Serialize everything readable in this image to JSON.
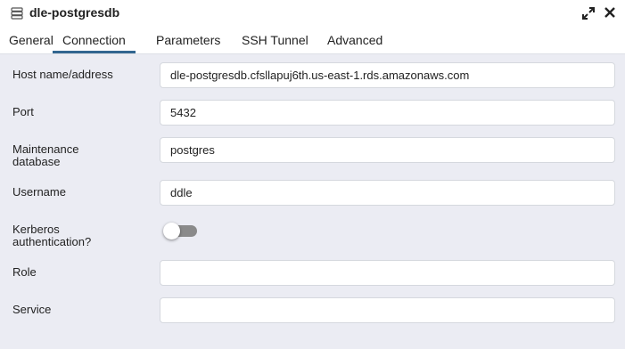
{
  "dialog": {
    "title": "dle-postgresdb",
    "icons": {
      "server": "server-database-icon",
      "expand": "expand-icon",
      "close": "close-icon"
    }
  },
  "tabs": [
    {
      "label": "General",
      "active": false
    },
    {
      "label": "Connection",
      "active": true
    },
    {
      "label": "Parameters",
      "active": false
    },
    {
      "label": "SSH Tunnel",
      "active": false
    },
    {
      "label": "Advanced",
      "active": false
    }
  ],
  "form": {
    "host": {
      "label": "Host name/address",
      "value": "dle-postgresdb.cfsllapuj6th.us-east-1.rds.amazonaws.com"
    },
    "port": {
      "label": "Port",
      "value": "5432"
    },
    "maintenance_db": {
      "label_line1": "Maintenance",
      "label_line2": "database",
      "value": "postgres"
    },
    "username": {
      "label": "Username",
      "value": "ddle"
    },
    "kerberos": {
      "label_line1": "Kerberos",
      "label_line2": "authentication?",
      "enabled": false
    },
    "role": {
      "label": "Role",
      "value": ""
    },
    "service": {
      "label": "Service",
      "value": ""
    }
  },
  "colors": {
    "background": "#ebecf3",
    "active_tab_underline": "#326690",
    "toggle_track_off": "#8a8a8a"
  }
}
